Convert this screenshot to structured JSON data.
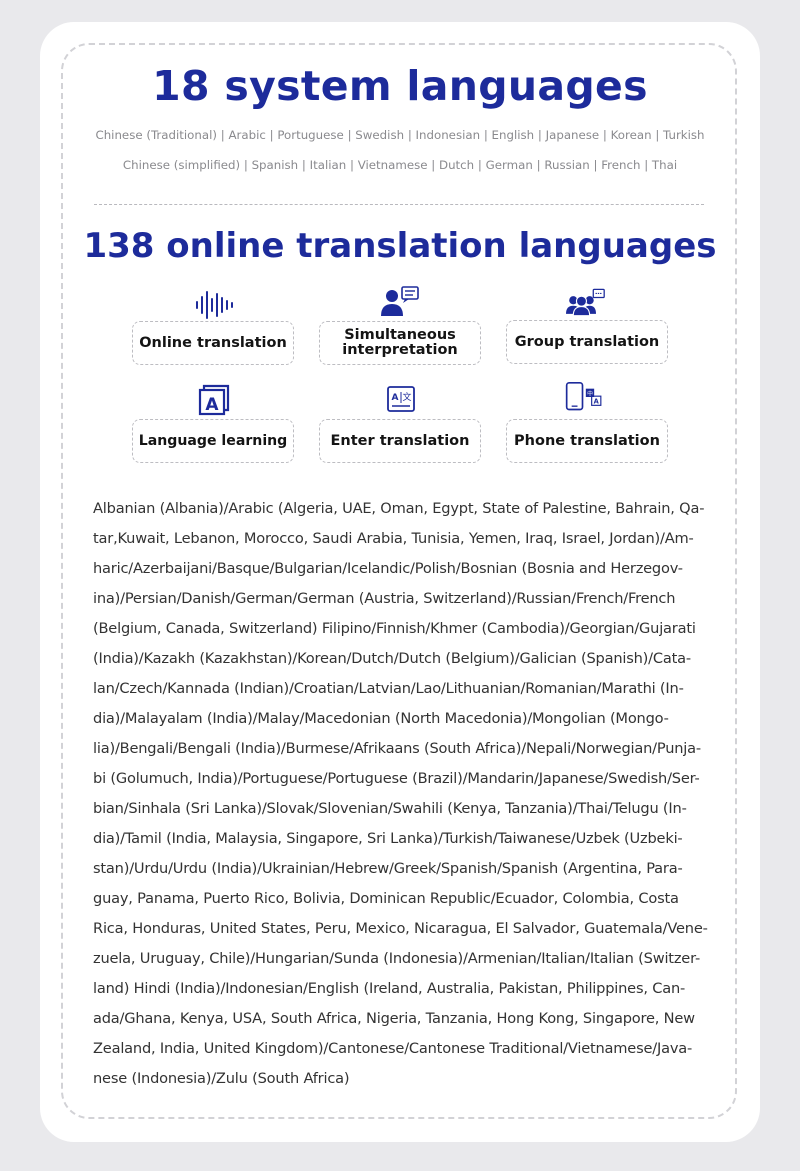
{
  "system": {
    "title": "18 system languages",
    "line1": "Chinese (Traditional) | Arabic | Portuguese | Swedish | Indonesian | English | Japanese | Korean | Turkish",
    "line2": "Chinese (simplified) | Spanish | Italian | Vietnamese | Dutch | German | Russian | French | Thai"
  },
  "online": {
    "title": "138 online translation languages",
    "features": [
      {
        "label": "Online translation",
        "icon": "sound-wave-icon"
      },
      {
        "label_line1": "Simultaneous",
        "label_line2": "interpretation",
        "icon": "speaker-chat-icon"
      },
      {
        "label": "Group translation",
        "icon": "group-chat-icon"
      },
      {
        "label": "Language learning",
        "icon": "letter-a-book-icon"
      },
      {
        "label": "Enter translation",
        "icon": "text-translate-icon"
      },
      {
        "label": "Phone translation",
        "icon": "phone-translate-icon"
      }
    ],
    "languages_list": [
      "Albanian (Albania)/Arabic (Algeria, UAE, Oman, Egypt, State of Palestine, Bahrain, Qa-",
      "tar,Kuwait, Lebanon, Morocco, Saudi Arabia, Tunisia, Yemen, Iraq, Israel, Jordan)/Am-",
      "haric/Azerbaijani/Basque/Bulgarian/Icelandic/Polish/Bosnian (Bosnia and Herzegov-",
      "ina)/Persian/Danish/German/German (Austria, Switzerland)/Russian/French/French",
      "(Belgium, Canada, Switzerland) Filipino/Finnish/Khmer (Cambodia)/Georgian/Gujarati",
      "(India)/Kazakh (Kazakhstan)/Korean/Dutch/Dutch (Belgium)/Galician (Spanish)/Cata-",
      "lan/Czech/Kannada (Indian)/Croatian/Latvian/Lao/Lithuanian/Romanian/Marathi (In-",
      "dia)/Malayalam (India)/Malay/Macedonian (North Macedonia)/Mongolian (Mongo-",
      "lia)/Bengali/Bengali (India)/Burmese/Afrikaans (South Africa)/Nepali/Norwegian/Punja-",
      "bi (Golumuch, India)/Portuguese/Portuguese (Brazil)/Mandarin/Japanese/Swedish/Ser-",
      "bian/Sinhala (Sri Lanka)/Slovak/Slovenian/Swahili (Kenya, Tanzania)/Thai/Telugu (In-",
      "dia)/Tamil (India, Malaysia, Singapore, Sri Lanka)/Turkish/Taiwanese/Uzbek (Uzbeki-",
      "stan)/Urdu/Urdu (India)/Ukrainian/Hebrew/Greek/Spanish/Spanish (Argentina, Para-",
      "guay, Panama, Puerto Rico, Bolivia, Dominican Republic/Ecuador, Colombia, Costa",
      "Rica, Honduras, United States, Peru, Mexico, Nicaragua, El Salvador, Guatemala/Vene-",
      "zuela, Uruguay, Chile)/Hungarian/Sunda (Indonesia)/Armenian/Italian/Italian (Switzer-",
      "land) Hindi (India)/Indonesian/English (Ireland, Australia, Pakistan, Philippines, Can-",
      "ada/Ghana, Kenya, USA, South Africa, Nigeria, Tanzania, Hong Kong, Singapore, New",
      "Zealand, India, United Kingdom)/Cantonese/Cantonese Traditional/Vietnamese/Java-",
      "nese (Indonesia)/Zulu (South Africa)"
    ]
  },
  "colors": {
    "accent": "#1d2b9b",
    "background": "#e9e9ec",
    "card": "#ffffff"
  }
}
